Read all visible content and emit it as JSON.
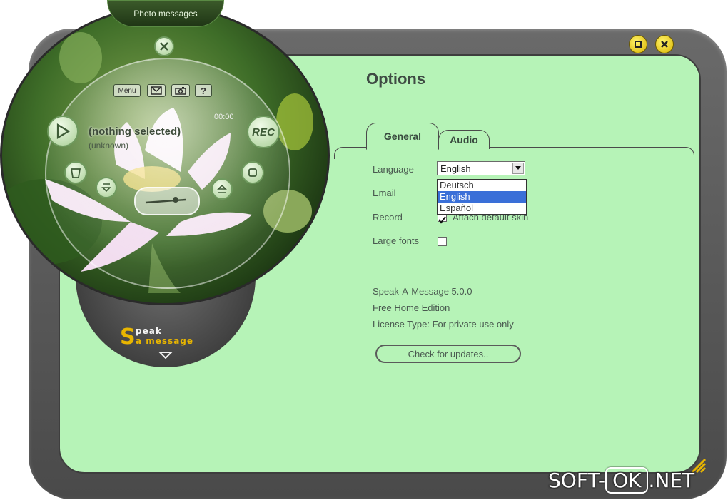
{
  "player": {
    "title": "Photo messages",
    "menu_label": "Menu",
    "help_label": "?",
    "rec_label": "REC",
    "now_playing": "(nothing selected)",
    "now_playing_sub": "(unknown)",
    "time": "00:00",
    "logo_letter": "S",
    "logo_line1": "peak",
    "logo_line2": "a message"
  },
  "options": {
    "title": "Options",
    "tabs": [
      {
        "label": "General",
        "active": true
      },
      {
        "label": "Audio",
        "active": false
      }
    ],
    "language_label": "Language",
    "language_value": "English",
    "language_options": [
      "Deutsch",
      "English",
      "Español"
    ],
    "language_selected_index": 1,
    "email_label": "Email",
    "record_label": "Record",
    "record_checkbox_text": "Attach default skin",
    "record_checked": true,
    "large_fonts_label": "Large fonts",
    "large_fonts_checked": false,
    "version": "Speak-A-Message 5.0.0",
    "edition": "Free Home Edition",
    "license": "License Type: For private use only",
    "check_updates_label": "Check for updates.."
  },
  "watermark": {
    "left": "SOFT-",
    "box": "OK",
    "right": ".NET"
  },
  "colors": {
    "panel": "#b6f3b7",
    "frame": "#5a5a5a",
    "accent": "#e8b500",
    "selection": "#3a6fd8"
  }
}
